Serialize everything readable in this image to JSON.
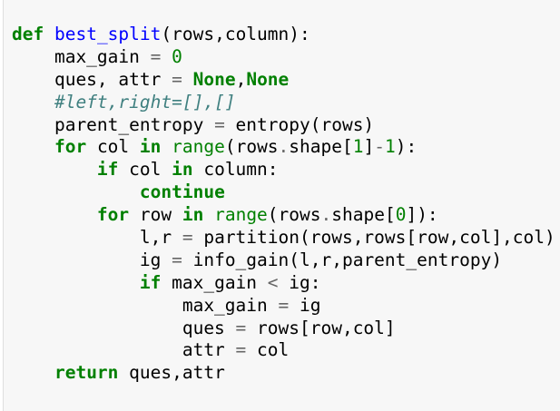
{
  "cell": {
    "lines": [
      [
        [
          "kw",
          "def"
        ],
        [
          "tx",
          " "
        ],
        [
          "fn",
          "best_split"
        ],
        [
          "tx",
          "(rows,column):"
        ]
      ],
      [
        [
          "tx",
          "    max_gain "
        ],
        [
          "op",
          "="
        ],
        [
          "tx",
          " "
        ],
        [
          "num",
          "0"
        ]
      ],
      [
        [
          "tx",
          "    ques, attr "
        ],
        [
          "op",
          "="
        ],
        [
          "tx",
          " "
        ],
        [
          "kw",
          "None"
        ],
        [
          "tx",
          ","
        ],
        [
          "kw",
          "None"
        ]
      ],
      [
        [
          "tx",
          "    "
        ],
        [
          "cm",
          "#left,right=[],[]"
        ]
      ],
      [
        [
          "tx",
          "    parent_entropy "
        ],
        [
          "op",
          "="
        ],
        [
          "tx",
          " entropy(rows)"
        ]
      ],
      [
        [
          "tx",
          "    "
        ],
        [
          "kw",
          "for"
        ],
        [
          "tx",
          " col "
        ],
        [
          "kw",
          "in"
        ],
        [
          "tx",
          " "
        ],
        [
          "bi",
          "range"
        ],
        [
          "tx",
          "(rows"
        ],
        [
          "op",
          "."
        ],
        [
          "tx",
          "shape["
        ],
        [
          "num",
          "1"
        ],
        [
          "tx",
          "]"
        ],
        [
          "op",
          "-"
        ],
        [
          "num",
          "1"
        ],
        [
          "tx",
          "):"
        ]
      ],
      [
        [
          "tx",
          "        "
        ],
        [
          "kw",
          "if"
        ],
        [
          "tx",
          " col "
        ],
        [
          "kw",
          "in"
        ],
        [
          "tx",
          " column:"
        ]
      ],
      [
        [
          "tx",
          "            "
        ],
        [
          "kw",
          "continue"
        ]
      ],
      [
        [
          "tx",
          "        "
        ],
        [
          "kw",
          "for"
        ],
        [
          "tx",
          " row "
        ],
        [
          "kw",
          "in"
        ],
        [
          "tx",
          " "
        ],
        [
          "bi",
          "range"
        ],
        [
          "tx",
          "(rows"
        ],
        [
          "op",
          "."
        ],
        [
          "tx",
          "shape["
        ],
        [
          "num",
          "0"
        ],
        [
          "tx",
          "]):"
        ]
      ],
      [
        [
          "tx",
          "            l,r "
        ],
        [
          "op",
          "="
        ],
        [
          "tx",
          " partition(rows,rows[row,col],col)"
        ]
      ],
      [
        [
          "tx",
          "            ig "
        ],
        [
          "op",
          "="
        ],
        [
          "tx",
          " info_gain(l,r,parent_entropy)"
        ]
      ],
      [
        [
          "tx",
          "            "
        ],
        [
          "kw",
          "if"
        ],
        [
          "tx",
          " max_gain "
        ],
        [
          "op",
          "<"
        ],
        [
          "tx",
          " ig:"
        ]
      ],
      [
        [
          "tx",
          "                max_gain "
        ],
        [
          "op",
          "="
        ],
        [
          "tx",
          " ig"
        ]
      ],
      [
        [
          "tx",
          "                ques "
        ],
        [
          "op",
          "="
        ],
        [
          "tx",
          " rows[row,col]"
        ]
      ],
      [
        [
          "tx",
          "                attr "
        ],
        [
          "op",
          "="
        ],
        [
          "tx",
          " col"
        ]
      ],
      [
        [
          "tx",
          "    "
        ],
        [
          "kw",
          "return"
        ],
        [
          "tx",
          " ques,attr"
        ]
      ]
    ]
  }
}
